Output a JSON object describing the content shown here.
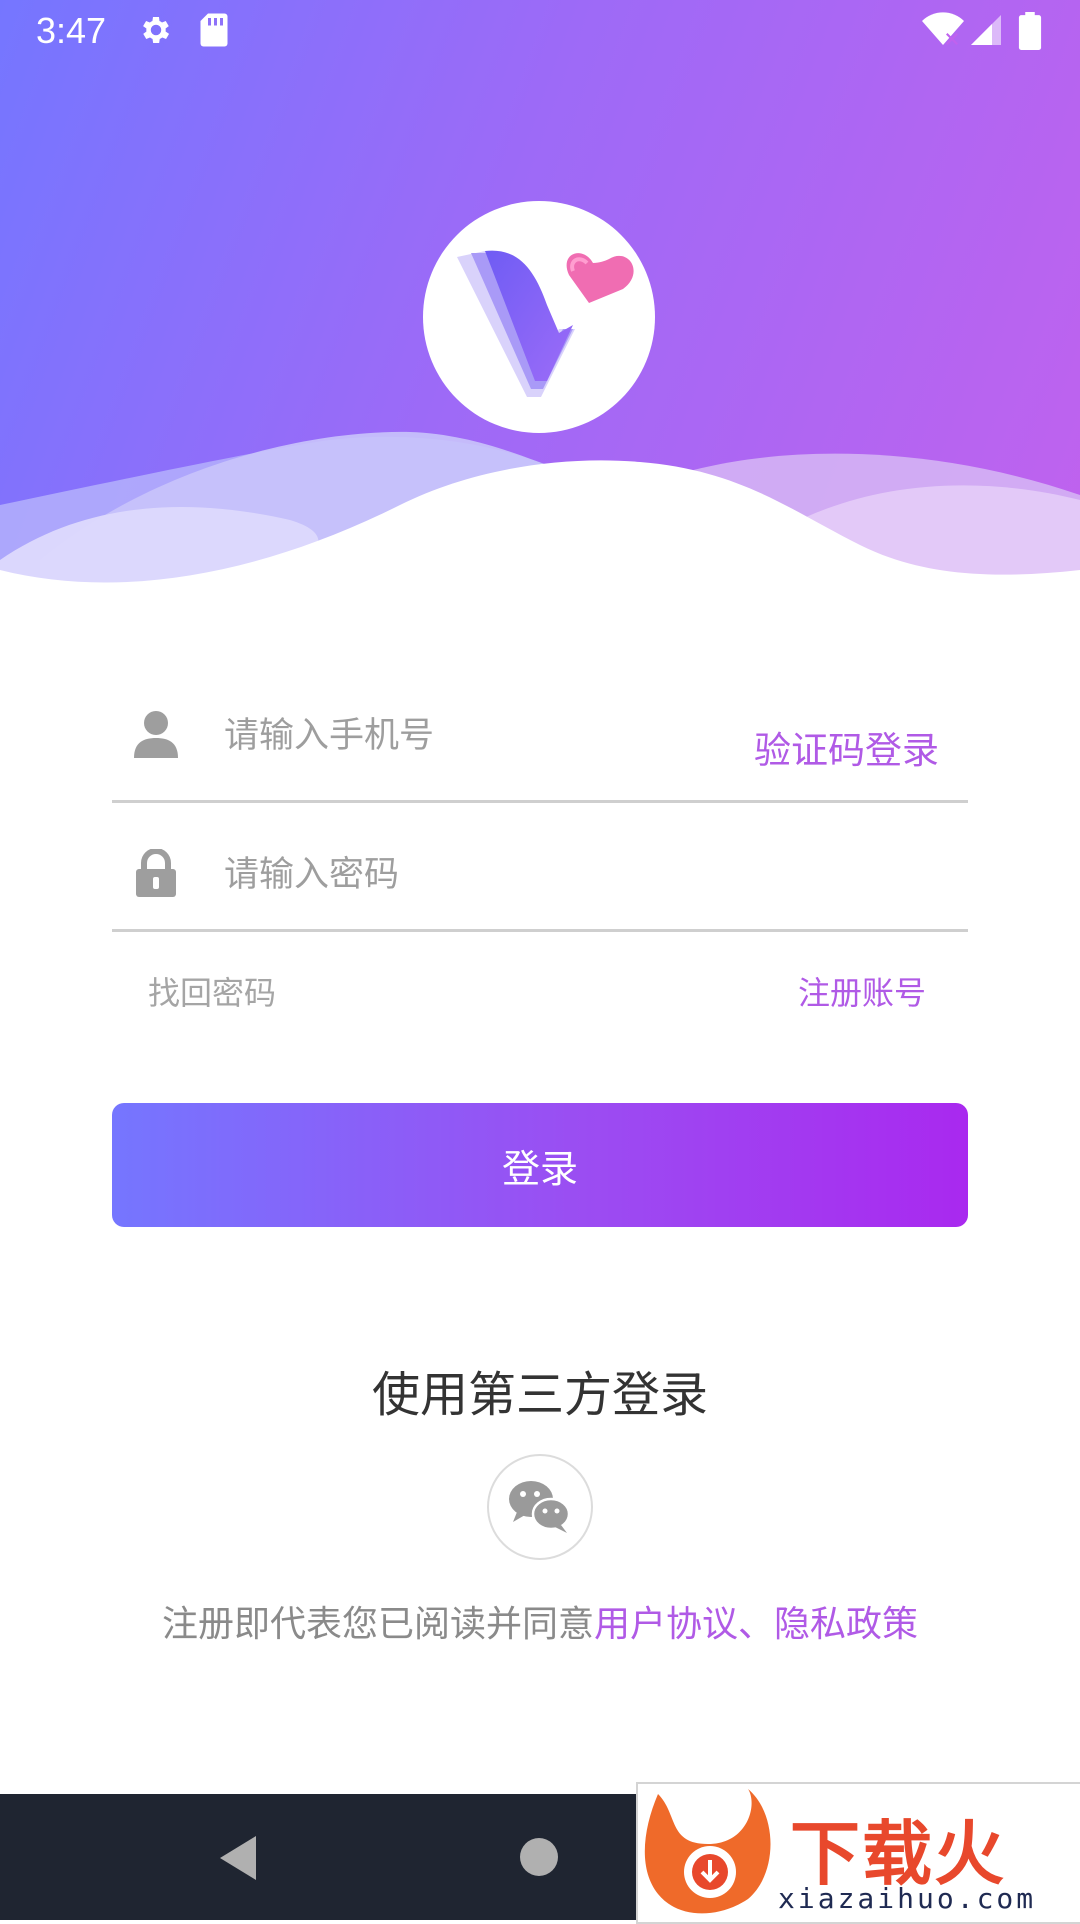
{
  "status_bar": {
    "time": "3:47",
    "icons": [
      "settings-icon",
      "sd-card-icon",
      "wifi-icon",
      "signal-icon",
      "battery-icon"
    ]
  },
  "colors": {
    "gradient_start": "#7576ff",
    "gradient_end": "#c062ee",
    "accent": "#b05ae6",
    "button_end": "#a929ef",
    "navbar": "#1f2531"
  },
  "login_form": {
    "phone_placeholder": "请输入手机号",
    "sms_login_label": "验证码登录",
    "password_placeholder": "请输入密码",
    "forgot_password_label": "找回密码",
    "register_label": "注册账号",
    "login_button_label": "登录"
  },
  "third_party": {
    "title": "使用第三方登录",
    "provider_icon": "wechat-icon"
  },
  "agreement": {
    "prefix": "注册即代表您已阅读并同意",
    "user_agreement": "用户协议",
    "separator": "、",
    "privacy_policy": "隐私政策"
  },
  "nav_bar": {
    "buttons": [
      "back-icon",
      "home-icon"
    ]
  },
  "watermark": {
    "text": "下载火",
    "url": "xiazaihuo.com"
  }
}
